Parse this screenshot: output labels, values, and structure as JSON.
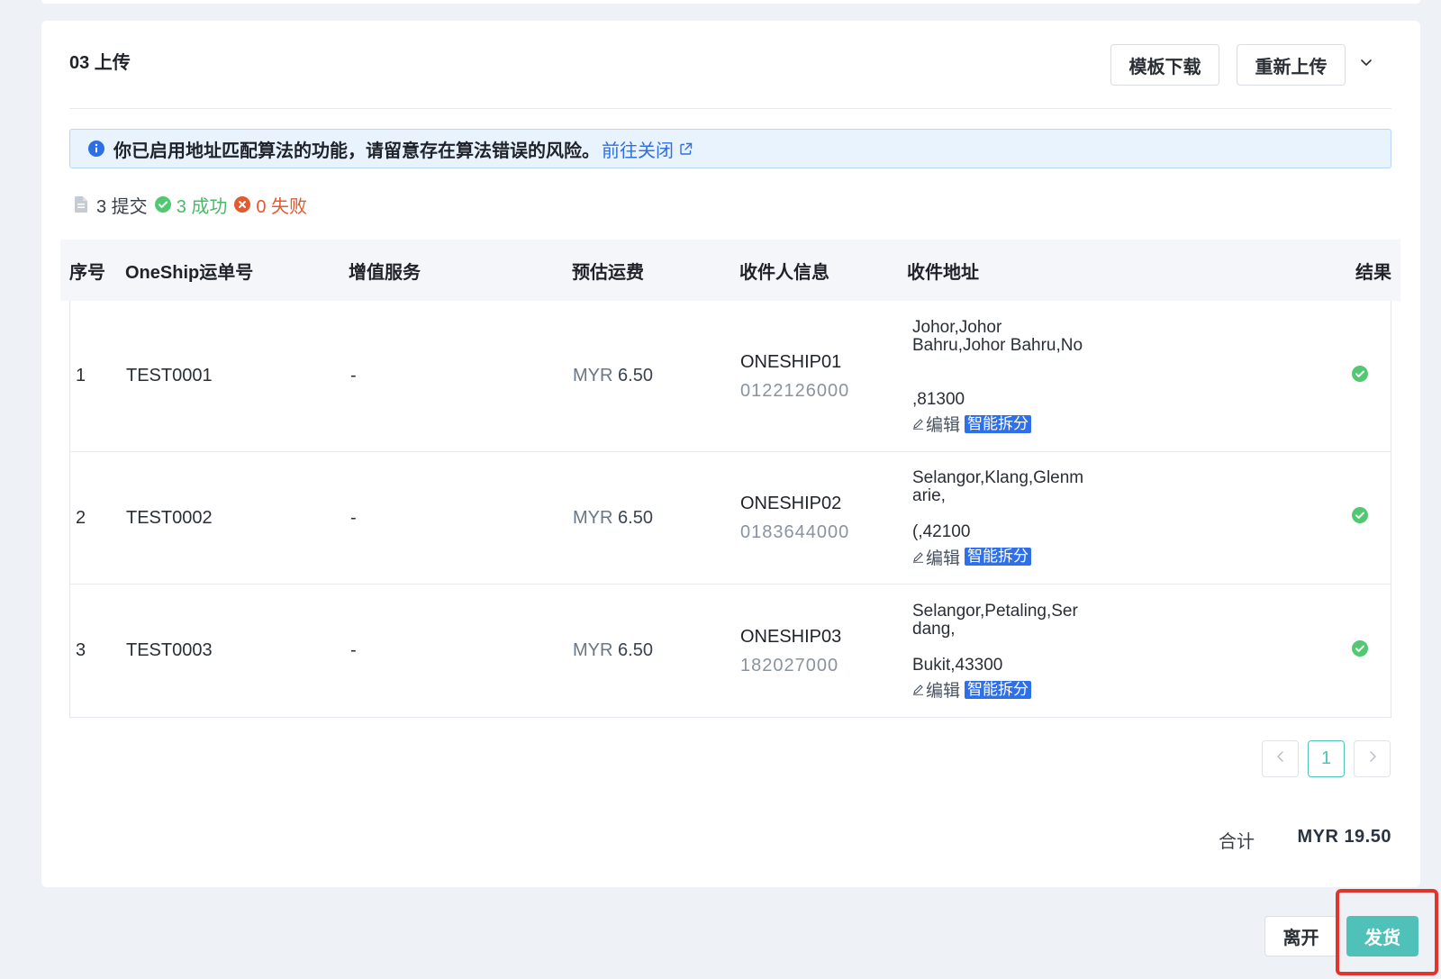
{
  "section": {
    "title": "03 上传"
  },
  "toolbar": {
    "download_label": "模板下载",
    "reupload_label": "重新上传"
  },
  "alert": {
    "text": "你已启用地址匹配算法的功能，请留意存在算法错误的风险。",
    "link": "前往关闭"
  },
  "stats": {
    "submitted": "3 提交",
    "success": "3 成功",
    "failed": "0 失败"
  },
  "table": {
    "headers": [
      "序号",
      "OneShip运单号",
      "增值服务",
      "预估运费",
      "收件人信息",
      "收件地址",
      "结果"
    ],
    "rows": [
      {
        "index": "1",
        "waybill": "TEST0001",
        "service": "-",
        "fee_currency": "MYR",
        "fee_amount": "6.50",
        "recipient_name": "ONESHIP01",
        "recipient_phone": "0122126000",
        "address_lines": [
          "Johor,Johor",
          "Bahru,Johor Bahru,No",
          ",81300"
        ],
        "edit_label": "编辑",
        "split_label": "智能拆分",
        "result_icon": "check-circle-icon"
      },
      {
        "index": "2",
        "waybill": "TEST0002",
        "service": "-",
        "fee_currency": "MYR",
        "fee_amount": "6.50",
        "recipient_name": "ONESHIP02",
        "recipient_phone": "0183644000",
        "address_lines": [
          "Selangor,Klang,Glenm",
          "arie,",
          "(,42100"
        ],
        "edit_label": "编辑",
        "split_label": "智能拆分",
        "result_icon": "check-circle-icon"
      },
      {
        "index": "3",
        "waybill": "TEST0003",
        "service": "-",
        "fee_currency": "MYR",
        "fee_amount": "6.50",
        "recipient_name": "ONESHIP03",
        "recipient_phone": "182027000",
        "address_lines": [
          "Selangor,Petaling,Ser",
          "dang,",
          "Bukit,43300"
        ],
        "edit_label": "编辑",
        "split_label": "智能拆分",
        "result_icon": "check-circle-icon"
      }
    ]
  },
  "pagination": {
    "current": "1"
  },
  "summary": {
    "label": "合计",
    "total": "MYR 19.50"
  },
  "footer": {
    "leave_label": "离开",
    "ship_label": "发货"
  },
  "icons": [
    "chevron-down-icon",
    "info-icon",
    "external-link-icon",
    "file-icon",
    "check-circle-icon",
    "error-circle-icon",
    "edit-icon",
    "chevron-left-icon",
    "chevron-right-icon"
  ],
  "colors": {
    "primary": "#50c1b8",
    "link": "#2f6fe4",
    "success": "#52c873",
    "danger": "#e35a2e",
    "alert_bg": "#e9f3fe",
    "highlight": "#e2332c"
  }
}
